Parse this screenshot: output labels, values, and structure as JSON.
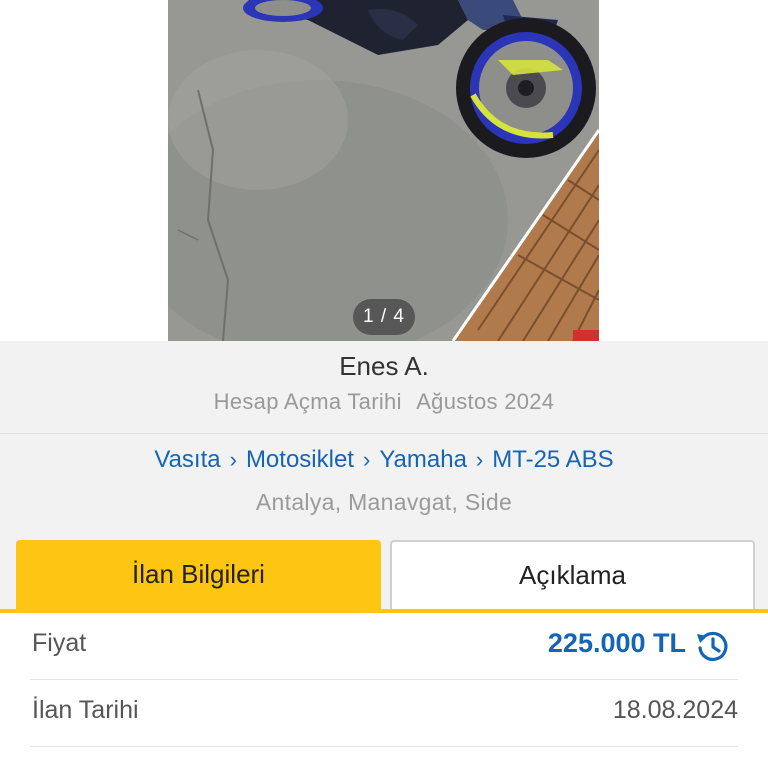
{
  "gallery": {
    "counter": "1 / 4"
  },
  "seller": {
    "name": "Enes A.",
    "since_label": "Hesap Açma Tarihi",
    "since_value": "Ağustos 2024"
  },
  "breadcrumb": {
    "items": [
      "Vasıta",
      "Motosiklet",
      "Yamaha",
      "MT-25 ABS"
    ],
    "separator": "›"
  },
  "location": "Antalya, Manavgat, Side",
  "tabs": [
    {
      "label": "İlan Bilgileri",
      "active": true
    },
    {
      "label": "Açıklama",
      "active": false
    }
  ],
  "details": {
    "price_label": "Fiyat",
    "price_value": "225.000 TL",
    "date_label": "İlan Tarihi",
    "date_value": "18.08.2024"
  },
  "icons": {
    "price_history": "price-history-icon",
    "breadcrumb_separator": "chevron-right-icon"
  },
  "colors": {
    "accent": "#fec512",
    "link": "#1565b6",
    "muted": "#999999"
  }
}
